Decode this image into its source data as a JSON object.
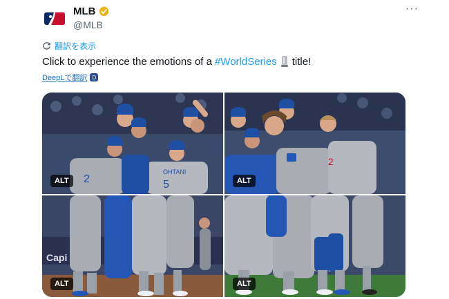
{
  "account": {
    "display_name": "MLB",
    "handle": "@MLB",
    "avatar_icon": "mlb-logo-icon",
    "verified_icon": "verified-badge-icon",
    "verified_color": "#e8b51a",
    "more_label": "···"
  },
  "translate": {
    "label": "翻訳を表示",
    "icon": "translate-icon"
  },
  "tweet": {
    "text_before": "Click to experience the emotions of a",
    "hashtag": "#WorldSeries",
    "emoji_icon": "trophy-icon",
    "text_after": "title!"
  },
  "deepl": {
    "label": "DeepLで翻訳",
    "badge": "D"
  },
  "media": {
    "alt_labels": [
      "ALT",
      "ALT",
      "ALT",
      "ALT"
    ]
  },
  "colors": {
    "link": "#1d9bf0",
    "text": "#0f1419",
    "muted": "#536471"
  }
}
